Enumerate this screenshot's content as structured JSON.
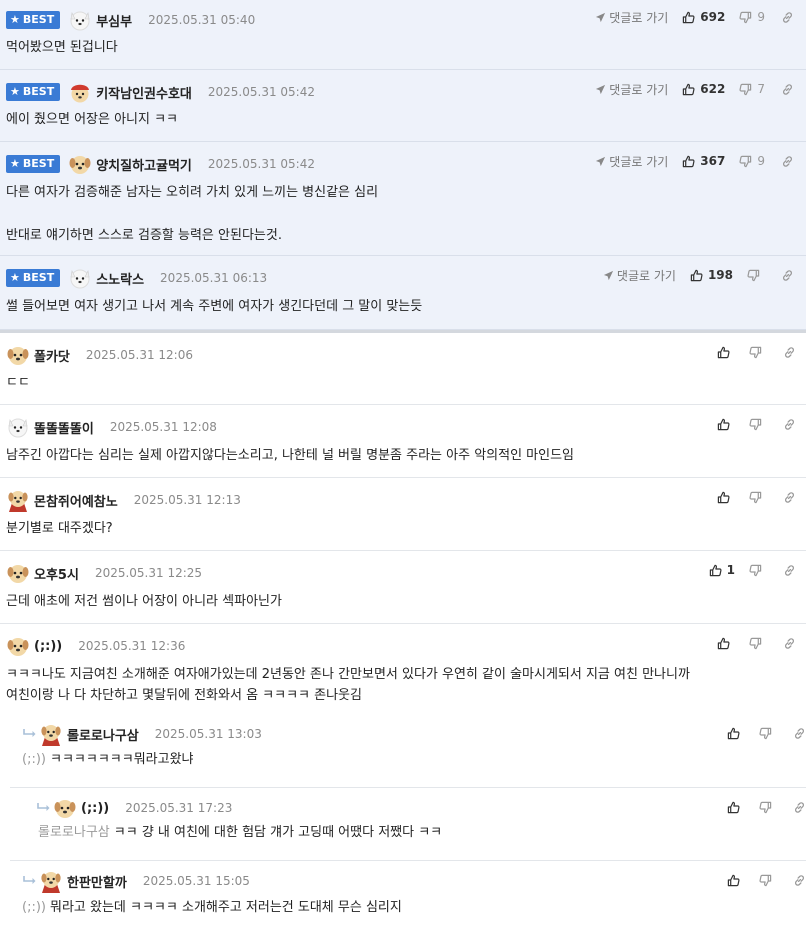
{
  "labels": {
    "best": "BEST",
    "goto_reply": "댓글로 가기"
  },
  "colors": {
    "best_badge": "#3a7bd5",
    "best_row_bg": "#eef2fa",
    "mention": "#9a9a9a"
  },
  "best_comments": [
    {
      "nick": "부심부",
      "time": "2025.05.31 05:40",
      "avatar": "white-dog-avatar",
      "lines": [
        "먹어봤으면 된겁니다"
      ],
      "up": "692",
      "down": "9"
    },
    {
      "nick": "키작남인권수호대",
      "time": "2025.05.31 05:42",
      "avatar": "red-cap-dog-avatar",
      "lines": [
        "에이 줬으면 어장은 아니지 ㅋㅋ"
      ],
      "up": "622",
      "down": "7"
    },
    {
      "nick": "양치질하고귤먹기",
      "time": "2025.05.31 05:42",
      "avatar": "puppy-avatar",
      "lines": [
        "다른 여자가 검증해준 남자는 오히려 가치 있게 느끼는 병신같은 심리",
        "",
        "반대로 얘기하면 스스로 검증할 능력은 안된다는것."
      ],
      "up": "367",
      "down": "9"
    },
    {
      "nick": "스노락스",
      "time": "2025.05.31 06:13",
      "avatar": "white-dog-avatar",
      "lines": [
        "썰 들어보면 여자 생기고 나서 계속 주변에 여자가 생긴다던데 그 말이 맞는듯"
      ],
      "up": "198",
      "down": ""
    }
  ],
  "comments": [
    {
      "nick": "폴카닷",
      "time": "2025.05.31 12:06",
      "avatar": "puppy-avatar",
      "lines": [
        "ㄷㄷ"
      ],
      "up": ""
    },
    {
      "nick": "똘똘똘똘이",
      "time": "2025.05.31 12:08",
      "avatar": "white-dog-avatar",
      "lines": [
        "남주긴 아깝다는 심리는 실제 아깝지않다는소리고, 나한테 널 버릴 명분좀 주라는 아주 악의적인 마인드임"
      ],
      "up": ""
    },
    {
      "nick": "몬참쥐어예참노",
      "time": "2025.05.31 12:13",
      "avatar": "cape-puppy-avatar",
      "lines": [
        "분기별로 대주겠다?"
      ],
      "up": ""
    },
    {
      "nick": "오후5시",
      "time": "2025.05.31 12:25",
      "avatar": "puppy-avatar",
      "lines": [
        "근데 애초에 저건 썸이나 어장이 아니라 섹파아닌가"
      ],
      "up": "1"
    },
    {
      "nick": "(;:))",
      "time": "2025.05.31 12:36",
      "avatar": "puppy-avatar",
      "lines": [
        "ㅋㅋㅋ나도 지금여친 소개해준 여자애가있는데 2년동안 존나 간만보면서 있다가 우연히 같이 술마시게되서 지금 여친 만나니까",
        "여친이랑 나 다 차단하고 몇달뒤에 전화와서 옴 ㅋㅋㅋㅋ 존나웃김"
      ],
      "up": ""
    }
  ],
  "replies": [
    {
      "nick": "롤로로나구삼",
      "time": "2025.05.31 13:03",
      "avatar": "cape-puppy-avatar",
      "mention": "(;:))",
      "text": "ㅋㅋㅋㅋㅋㅋㅋ뭐라고왔냐",
      "up": ""
    },
    {
      "nick": "(;:))",
      "time": "2025.05.31 17:23",
      "avatar": "puppy-avatar",
      "mention": "롤로로나구삼",
      "text": "ㅋㅋ 걍 내 여친에 대한 험담 걔가 고딩때 어땠다 저쨌다 ㅋㅋ",
      "up": ""
    },
    {
      "nick": "한판만할까",
      "time": "2025.05.31 15:05",
      "avatar": "cape-puppy-avatar",
      "mention": "(;:))",
      "text": "뭐라고 왔는데 ㅋㅋㅋㅋ 소개해주고 저러는건 도대체 무슨 심리지",
      "up": ""
    }
  ]
}
